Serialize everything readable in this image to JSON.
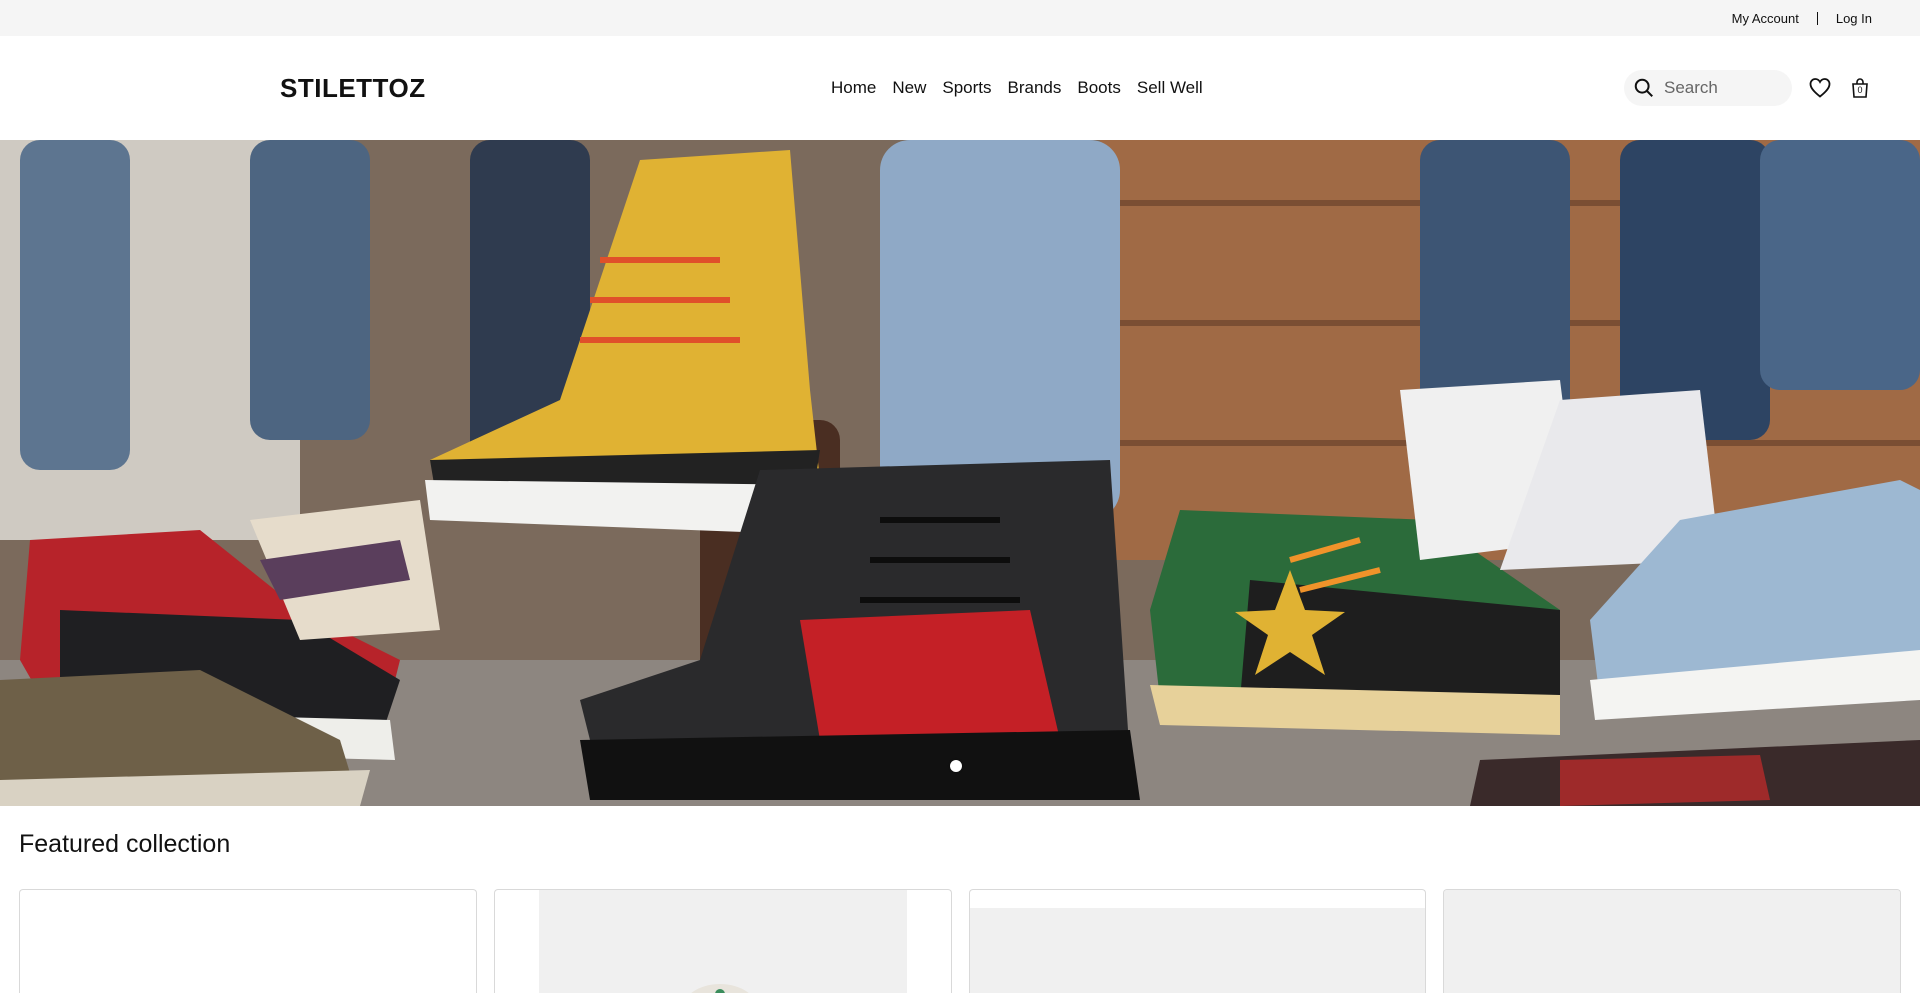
{
  "utility": {
    "my_account": "My Account",
    "log_in": "Log In"
  },
  "header": {
    "logo": "STILETTOZ",
    "nav": [
      "Home",
      "New",
      "Sports",
      "Brands",
      "Boots",
      "Sell Well"
    ],
    "search_placeholder": "Search",
    "cart_count": "0"
  },
  "hero": {
    "slide_count_indicator": "1"
  },
  "featured": {
    "title": "Featured collection"
  },
  "icons": {
    "search": "search-icon",
    "wishlist": "heart-icon",
    "cart": "shopping-bag-icon"
  }
}
